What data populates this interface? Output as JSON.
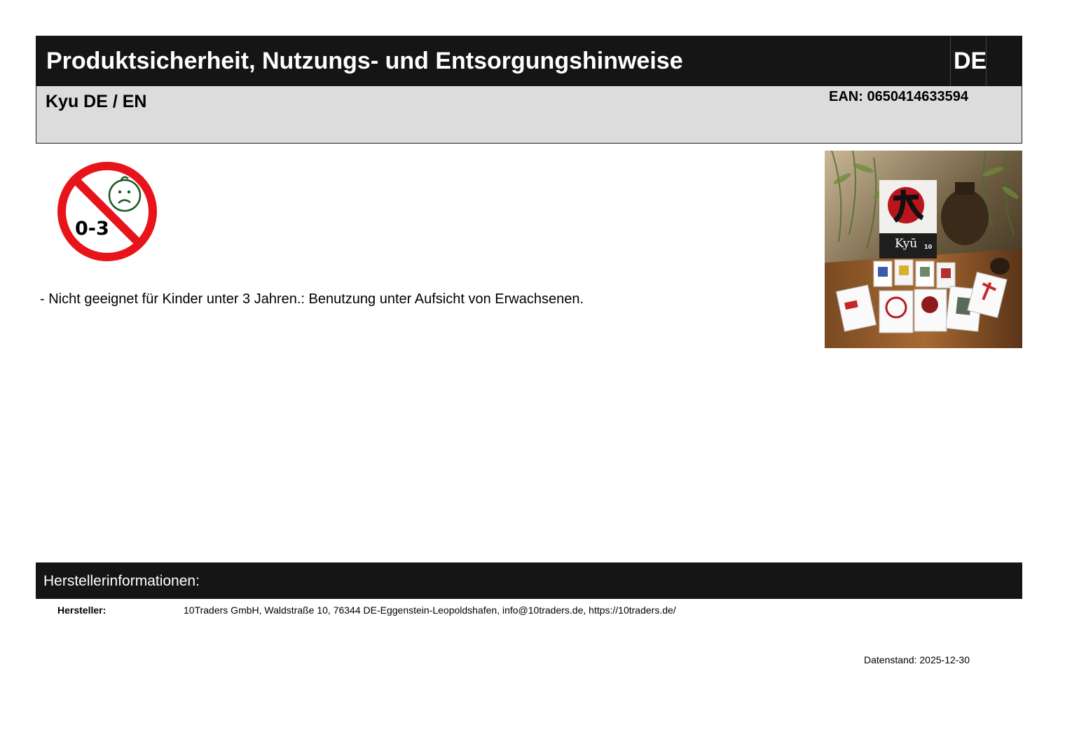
{
  "header": {
    "title": "Produktsicherheit, Nutzungs- und Entsorgungshinweise",
    "language": "DE"
  },
  "product": {
    "name": "Kyu DE / EN",
    "ean": "EAN: 0650414633594"
  },
  "age_warning": {
    "icon": "no-under-3-icon",
    "icon_text": "0-3",
    "text": "- Nicht geeignet für Kinder unter 3 Jahren.: Benutzung unter Aufsicht von Erwachsenen."
  },
  "product_image": {
    "box_title": "Kyū",
    "box_badge": "10"
  },
  "manufacturer": {
    "section_title": "Herstellerinformationen:",
    "label": "Hersteller:",
    "value": "10Traders GmbH, Waldstraße 10, 76344 DE-Eggenstein-Leopoldshafen, info@10traders.de, https://10traders.de/"
  },
  "footer": {
    "date": "Datenstand: 2025-12-30"
  },
  "colors": {
    "header_bg": "#151515",
    "sub_bg": "#dcdcdc",
    "warning_red": "#e8141b",
    "face_green": "#1c5a23"
  }
}
